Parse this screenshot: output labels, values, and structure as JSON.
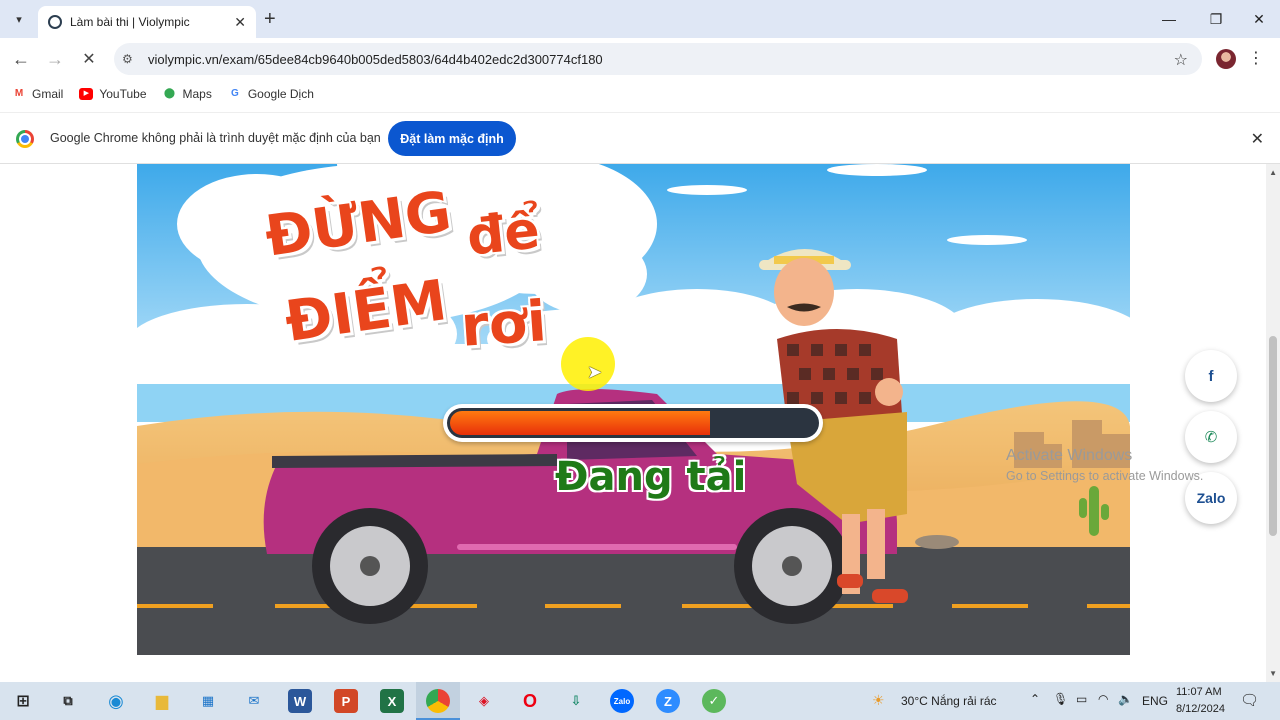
{
  "browser": {
    "tab_title": "Làm bài thi | Violympic",
    "url": "violympic.vn/exam/65dee84cb9640b005ded5803/64d4b402edc2d300774cf180",
    "bookmarks": [
      {
        "label": "Gmail",
        "icon": "gmail-icon",
        "color": "#ea4335"
      },
      {
        "label": "YouTube",
        "icon": "youtube-icon",
        "color": "#ff0000"
      },
      {
        "label": "Maps",
        "icon": "maps-icon",
        "color": "#34a853"
      },
      {
        "label": "Google Dịch",
        "icon": "translate-icon",
        "color": "#4285f4"
      }
    ],
    "infobar": {
      "text": "Google Chrome không phải là trình duyệt mặc định của bạn",
      "button": "Đặt làm mặc định"
    }
  },
  "game": {
    "headline": [
      "ĐỪNG",
      "để",
      "ĐIỂM",
      "rơi"
    ],
    "loading_label": "Đang tải",
    "progress_fraction": 0.71
  },
  "social": {
    "facebook": "f",
    "zalo": "Zalo"
  },
  "watermark": {
    "line1": "Activate Windows",
    "line2": "Go to Settings to activate Windows."
  },
  "taskbar": {
    "weather": "30°C  Nắng rải rác",
    "lang": "ENG",
    "time": "11:07 AM",
    "date": "8/12/2024"
  }
}
